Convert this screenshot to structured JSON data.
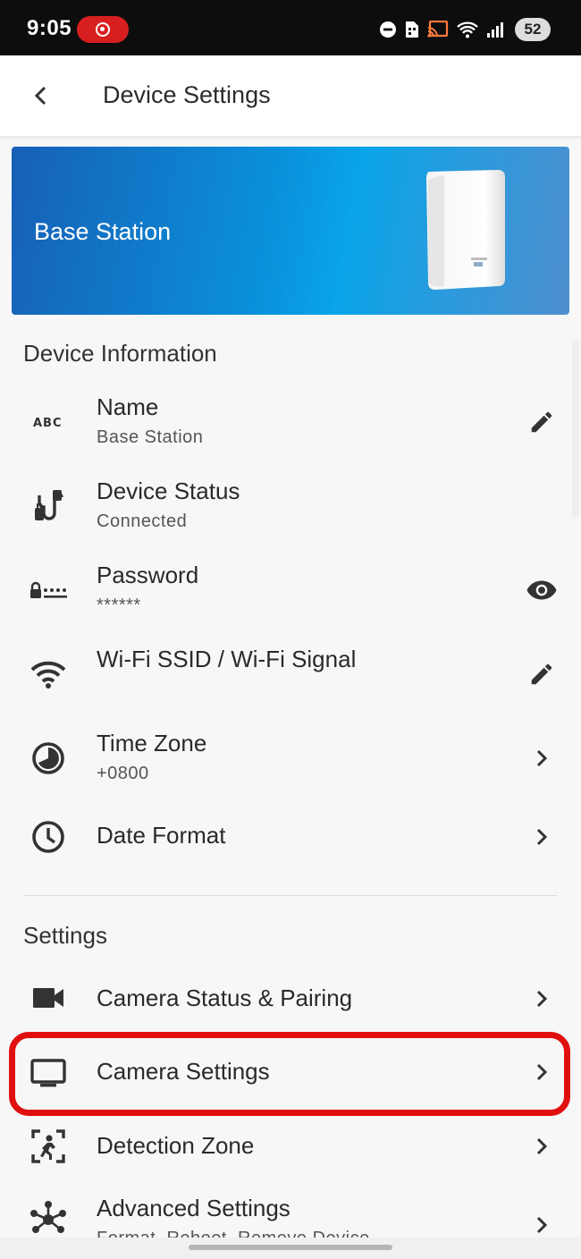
{
  "status_bar": {
    "time": "9:05",
    "battery": "52",
    "icons": [
      "do-not-disturb-icon",
      "sim-card-icon",
      "cast-icon",
      "wifi-icon",
      "signal-icon"
    ]
  },
  "app_bar": {
    "back_icon": "arrow-back-icon",
    "title": "Device Settings"
  },
  "banner": {
    "label": "Base Station",
    "image": "base-station-device-image"
  },
  "device_information": {
    "title": "Device Information",
    "items": [
      {
        "icon": "abc-text-icon",
        "label": "Name",
        "value": "Base Station",
        "action_icon": "edit-pencil-icon"
      },
      {
        "icon": "power-plug-icon",
        "label": "Device Status",
        "value": "Connected"
      },
      {
        "icon": "password-icon",
        "label": "Password",
        "value": "******",
        "action_icon": "eye-visibility-icon"
      },
      {
        "icon": "wifi-icon",
        "label": "Wi-Fi SSID / Wi-Fi Signal",
        "action_icon": "edit-pencil-icon"
      },
      {
        "icon": "time-zone-icon",
        "label": "Time Zone",
        "value": "+0800",
        "action_icon": "chevron-right-icon"
      },
      {
        "icon": "clock-icon",
        "label": "Date Format",
        "action_icon": "chevron-right-icon"
      }
    ]
  },
  "settings": {
    "title": "Settings",
    "items": [
      {
        "icon": "video-camera-icon",
        "label": "Camera Status & Pairing",
        "action_icon": "chevron-right-icon"
      },
      {
        "icon": "monitor-icon",
        "label": "Camera Settings",
        "action_icon": "chevron-right-icon"
      },
      {
        "icon": "detection-zone-icon",
        "label": "Detection Zone",
        "action_icon": "chevron-right-icon"
      },
      {
        "icon": "hub-network-icon",
        "label": "Advanced Settings",
        "value": "Format, Reboot, Remove Device",
        "action_icon": "chevron-right-icon"
      }
    ]
  },
  "colors": {
    "highlight": "#e01010",
    "banner_start": "#1760b6",
    "banner_end": "#4f8fcf"
  }
}
